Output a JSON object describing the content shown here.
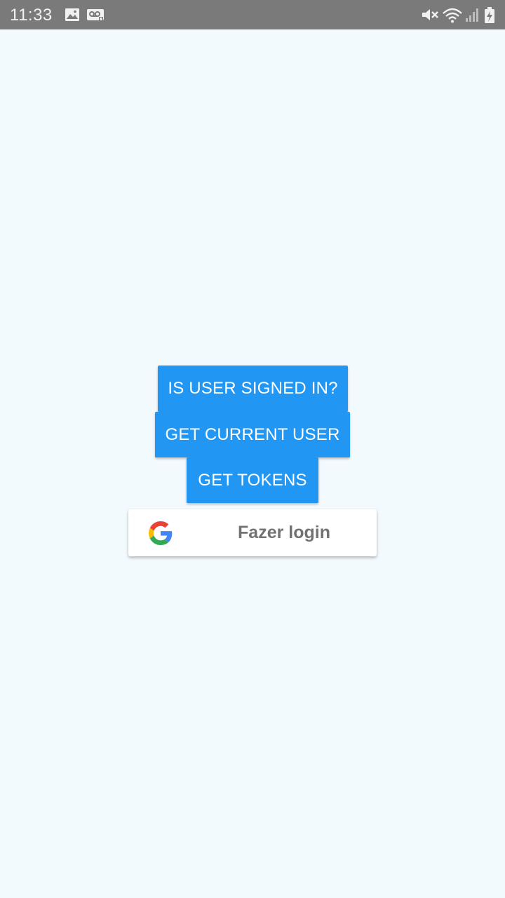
{
  "status_bar": {
    "time": "11:33",
    "left_icons": [
      "image-icon",
      "voicemail-icon"
    ],
    "right_icons": [
      "mute-icon",
      "wifi-icon",
      "signal-icon",
      "battery-charging-icon"
    ]
  },
  "buttons": {
    "is_signed_in": "IS USER SIGNED IN?",
    "get_current_user": "GET CURRENT USER",
    "get_tokens": "GET TOKENS",
    "google_login": "Fazer login"
  },
  "colors": {
    "primary": "#2196F3",
    "background": "#F3FAFE",
    "status_bar": "#7A7A7A"
  }
}
